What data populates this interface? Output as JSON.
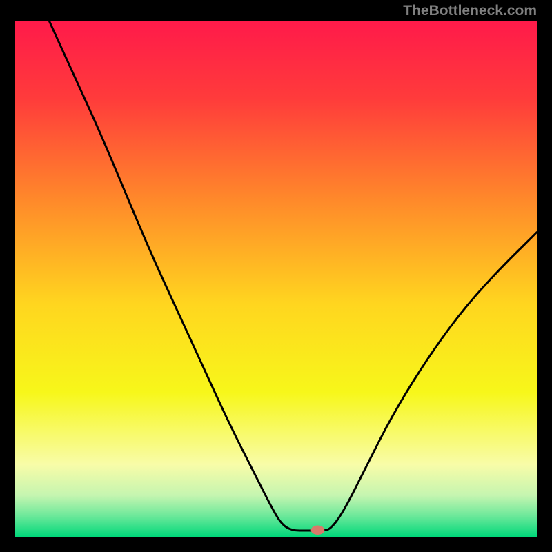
{
  "watermark": "TheBottleneck.com",
  "chart_data": {
    "type": "line",
    "title": "",
    "xlabel": "",
    "ylabel": "",
    "xlim": [
      0,
      100
    ],
    "ylim": [
      0,
      100
    ],
    "background_gradient": {
      "stops": [
        {
          "offset": 0.0,
          "color": "#ff1a4a"
        },
        {
          "offset": 0.15,
          "color": "#ff3b3b"
        },
        {
          "offset": 0.35,
          "color": "#ff8a2a"
        },
        {
          "offset": 0.55,
          "color": "#ffd61f"
        },
        {
          "offset": 0.72,
          "color": "#f7f71a"
        },
        {
          "offset": 0.86,
          "color": "#f8fca8"
        },
        {
          "offset": 0.92,
          "color": "#c5f5b0"
        },
        {
          "offset": 0.96,
          "color": "#6be89a"
        },
        {
          "offset": 1.0,
          "color": "#00d87a"
        }
      ]
    },
    "series": [
      {
        "name": "bottleneck-curve",
        "color": "#000000",
        "points": [
          {
            "x": 6.5,
            "y": 100
          },
          {
            "x": 11,
            "y": 90
          },
          {
            "x": 16,
            "y": 79
          },
          {
            "x": 21,
            "y": 67
          },
          {
            "x": 26,
            "y": 55
          },
          {
            "x": 31,
            "y": 44
          },
          {
            "x": 36,
            "y": 33
          },
          {
            "x": 41,
            "y": 22
          },
          {
            "x": 46,
            "y": 12
          },
          {
            "x": 49,
            "y": 6
          },
          {
            "x": 51,
            "y": 2.5
          },
          {
            "x": 53,
            "y": 1.2
          },
          {
            "x": 56,
            "y": 1.2
          },
          {
            "x": 59,
            "y": 1.2
          },
          {
            "x": 60.5,
            "y": 1.5
          },
          {
            "x": 63,
            "y": 5
          },
          {
            "x": 67,
            "y": 13
          },
          {
            "x": 72,
            "y": 23
          },
          {
            "x": 78,
            "y": 33
          },
          {
            "x": 85,
            "y": 43
          },
          {
            "x": 92,
            "y": 51
          },
          {
            "x": 100,
            "y": 59
          }
        ]
      }
    ],
    "marker": {
      "x": 58,
      "y": 1.3,
      "rx": 1.3,
      "ry": 0.9,
      "color": "#d87a6a"
    }
  }
}
